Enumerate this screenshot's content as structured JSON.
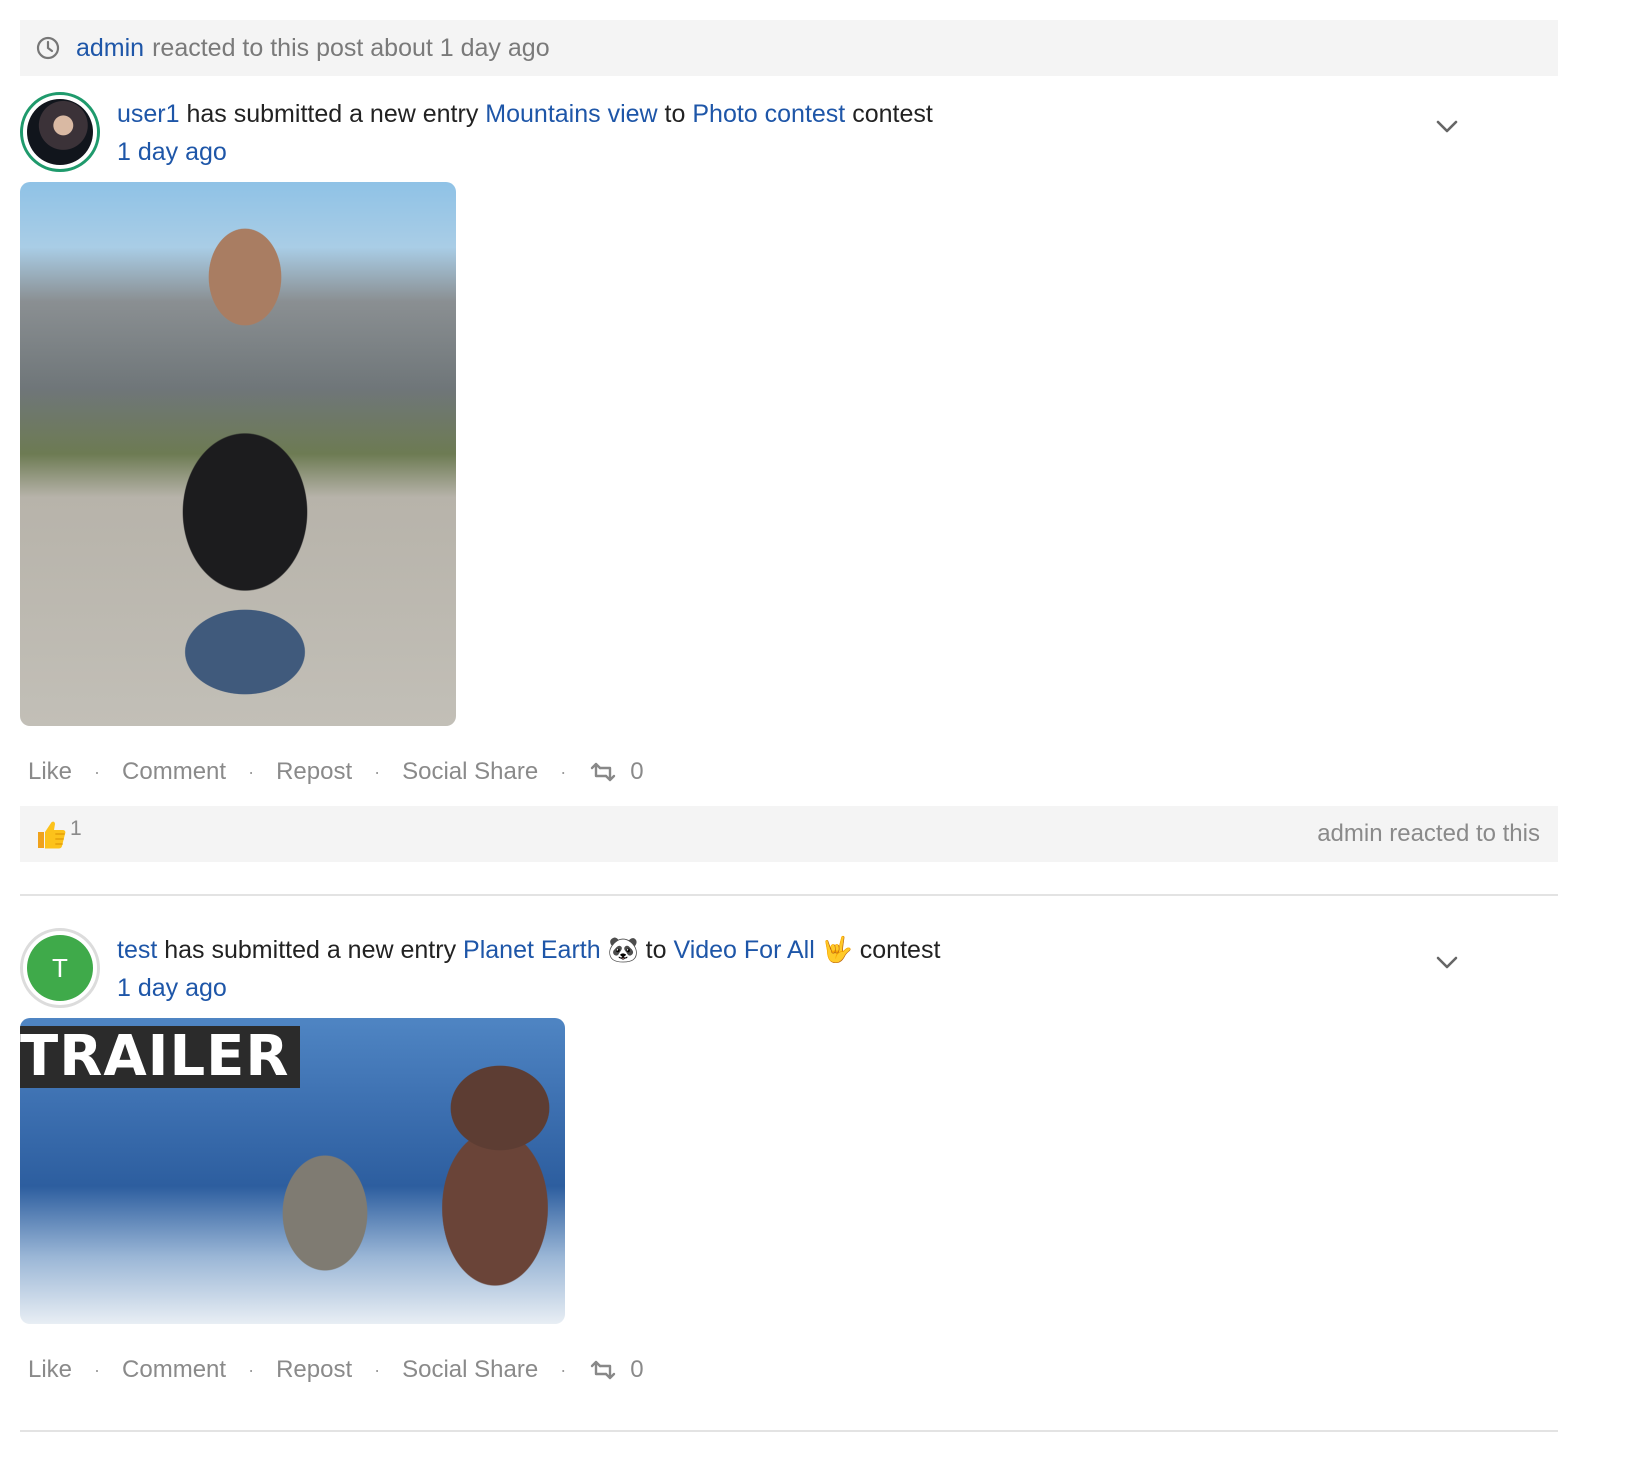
{
  "notice": {
    "actor": "admin",
    "text": "reacted to this post about 1 day ago"
  },
  "posts": [
    {
      "author": "user1",
      "verb": "has submitted a new entry",
      "entry": "Mountains view",
      "to": "to",
      "contest": "Photo contest",
      "suffix": "contest",
      "time": "1 day ago",
      "actions": {
        "like": "Like",
        "comment": "Comment",
        "repost": "Repost",
        "share": "Social Share",
        "repost_count": "0"
      },
      "reactions": {
        "count": "1",
        "summary": "admin reacted to this"
      }
    },
    {
      "author": "test",
      "avatar_letter": "T",
      "verb": "has submitted a new entry",
      "entry": "Planet Earth 🐼",
      "to": "to",
      "contest": "Video For All 🤟",
      "suffix": "contest",
      "time": "1 day ago",
      "media_label": "TRAILER",
      "actions": {
        "like": "Like",
        "comment": "Comment",
        "repost": "Repost",
        "share": "Social Share",
        "repost_count": "0"
      }
    }
  ],
  "colors": {
    "link": "#1e56a8",
    "avatar_green": "#3faa4a",
    "avatar_ring": "#1f9a6c",
    "panel_bg": "#f4f4f4"
  }
}
